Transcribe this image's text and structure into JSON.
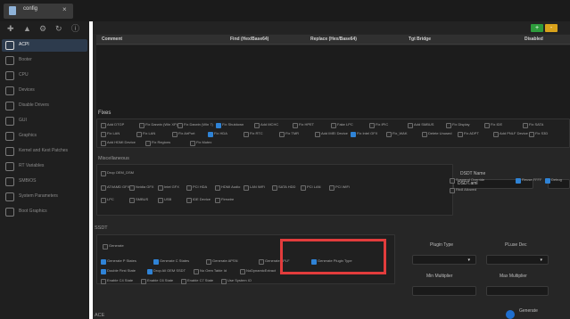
{
  "window": {
    "tab_title": "config",
    "close_glyph": "×"
  },
  "toolbar": {
    "icons": [
      "plus-icon",
      "info-icon",
      "gear-icon",
      "refresh-icon",
      "help-icon"
    ]
  },
  "sidebar": {
    "items": [
      {
        "label": "ACPI",
        "icon": "acpi-icon",
        "active": true
      },
      {
        "label": "Booter",
        "icon": "booter-icon",
        "active": false
      },
      {
        "label": "CPU",
        "icon": "cpu-icon",
        "active": false
      },
      {
        "label": "Devices",
        "icon": "devices-icon",
        "active": false
      },
      {
        "label": "Disable Drivers",
        "icon": "disable-drivers-icon",
        "active": false
      },
      {
        "label": "GUI",
        "icon": "gui-icon",
        "active": false
      },
      {
        "label": "Graphics",
        "icon": "graphics-icon",
        "active": false
      },
      {
        "label": "Kernel and Kext Patches",
        "icon": "kernel-icon",
        "active": false
      },
      {
        "label": "RT Variables",
        "icon": "rt-variables-icon",
        "active": false
      },
      {
        "label": "SMBIOS",
        "icon": "smbios-icon",
        "active": false
      },
      {
        "label": "System Parameters",
        "icon": "system-parameters-icon",
        "active": false
      },
      {
        "label": "Boot Graphics",
        "icon": "boot-graphics-icon",
        "active": false
      }
    ]
  },
  "header_buttons": {
    "add": "+",
    "remove": "-"
  },
  "table": {
    "headers": [
      "Comment",
      "Find (Hex/Base64)",
      "Replace (Hex/Base64)",
      "Tgt Bridge",
      "Disabled"
    ]
  },
  "fixes": {
    "title": "Fixes",
    "row1": [
      {
        "label": "Add DTGP",
        "on": false
      },
      {
        "label": "Fix Darwin (Win XP)",
        "on": false
      },
      {
        "label": "Fix Darwin (Win 7)",
        "on": false
      },
      {
        "label": "Fix Shutdown",
        "on": true
      },
      {
        "label": "Add MCHC",
        "on": false
      },
      {
        "label": "Fix HPET",
        "on": false
      },
      {
        "label": "Fake LPC",
        "on": false
      },
      {
        "label": "Fix IPIC",
        "on": false
      },
      {
        "label": "Add SMBUS",
        "on": false
      },
      {
        "label": "Fix Display",
        "on": false
      },
      {
        "label": "Fix IDE",
        "on": false
      },
      {
        "label": "Fix SATA",
        "on": false
      }
    ],
    "row2": [
      {
        "label": "Fix LAN",
        "on": false
      },
      {
        "label": "Fix LAN",
        "on": false
      },
      {
        "label": "Fix AirPort",
        "on": false
      },
      {
        "label": "Fix HDA",
        "on": true
      },
      {
        "label": "Fix RTC",
        "on": false
      },
      {
        "label": "Fix TMR",
        "on": false
      },
      {
        "label": "Add IMEI Device",
        "on": false
      },
      {
        "label": "Fix Intel GFX",
        "on": true
      },
      {
        "label": "Fix_WAK",
        "on": false
      },
      {
        "label": "Delete Unused",
        "on": false
      },
      {
        "label": "Fix ADPT",
        "on": false
      },
      {
        "label": "Add PNLF Device",
        "on": false
      },
      {
        "label": "Fix S3D",
        "on": false
      }
    ],
    "row3": [
      {
        "label": "Add HDMI Device",
        "on": false
      },
      {
        "label": "Fix Regions",
        "on": false
      },
      {
        "label": "Fix Mutex",
        "on": false
      }
    ]
  },
  "misc": {
    "title": "Miscellaneous",
    "drop": {
      "label": "Drop OEM_DSM",
      "on": false
    },
    "row1": [
      "ATI/AMD GFX",
      "Nvidia GFX",
      "Intel GFX",
      "PCI HDA",
      "HDMI Audio",
      "LAN WiFi",
      "SATA HDD",
      "PCI LAN",
      "PCI WiFi"
    ],
    "row2": [
      "LPC",
      "SMBUS",
      "USB",
      "IDE Device",
      "Firewire"
    ]
  },
  "dsdt": {
    "name_label": "DSDT Name",
    "name_value": "DSDT.aml",
    "opts": [
      {
        "label": "Suspend Override",
        "on": false
      },
      {
        "label": "Reuse FFFF",
        "on": true
      },
      {
        "label": "Debug",
        "on": true
      },
      {
        "label": "Rtc8 Allowed",
        "on": false
      }
    ]
  },
  "ssdt": {
    "title": "SSDT",
    "generate": "Generate",
    "row1": [
      {
        "label": "Generate P States",
        "on": true
      },
      {
        "label": "Generate C States",
        "on": true
      },
      {
        "label": "Generate APSN",
        "on": false
      },
      {
        "label": "Generate APLF",
        "on": false
      },
      {
        "label": "Generate Plugin Type",
        "on": true
      }
    ],
    "row2": [
      {
        "label": "Double First State",
        "on": true
      },
      {
        "label": "Drop All OEM SSDT",
        "on": true
      },
      {
        "label": "No Oem Table Id",
        "on": false
      },
      {
        "label": "NoDynamicExtract",
        "on": false
      }
    ],
    "row3": [
      {
        "label": "Enable C4 State",
        "on": false
      },
      {
        "label": "Enable C6 State",
        "on": false
      },
      {
        "label": "Enable C7 State",
        "on": false
      },
      {
        "label": "Use System IO",
        "on": false
      }
    ],
    "plugin_type_label": "Plugin Type",
    "pluse_dec_label": "PLuse Dec",
    "min_multiplier_label": "Min Multiplier",
    "max_multiplier_label": "Max Multiplier",
    "generate_label": "Generate"
  },
  "bottom": {
    "label": "ACE"
  },
  "colors": {
    "highlight": "#e23c3c",
    "add_button": "#2e9b3c",
    "remove_button": "#d9a21b",
    "accent": "#2f83d6"
  }
}
